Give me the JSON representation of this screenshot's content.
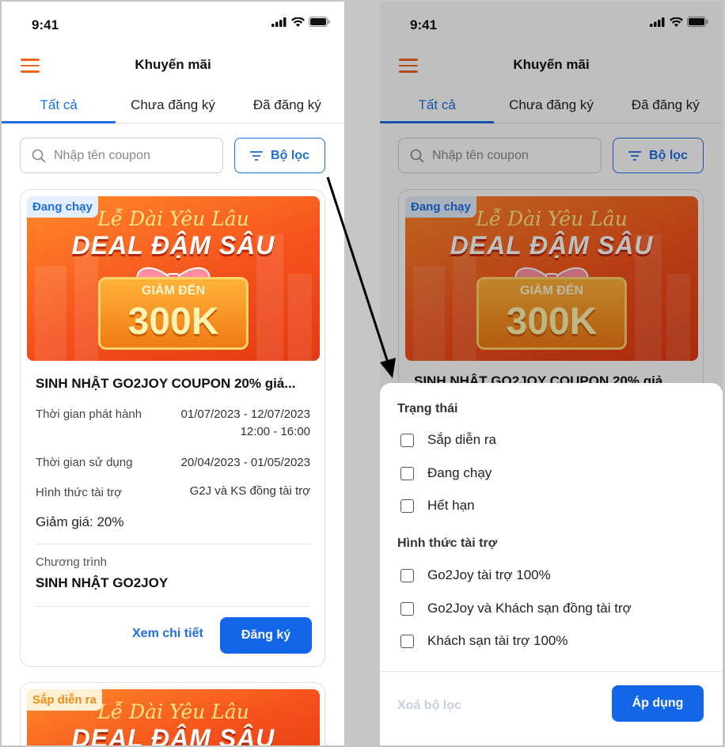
{
  "status": {
    "time": "9:41"
  },
  "header": {
    "title": "Khuyến mãi"
  },
  "tabs": [
    {
      "label": "Tất cả",
      "active": true
    },
    {
      "label": "Chưa đăng ký",
      "active": false
    },
    {
      "label": "Đã đăng ký",
      "active": false
    }
  ],
  "search": {
    "placeholder": "Nhập tên coupon"
  },
  "filter_button": {
    "label": "Bộ lọc"
  },
  "card": {
    "badge": "Đang chạy",
    "banner": {
      "line1": "Lễ Dài Yêu Lâu",
      "line2": "DEAL ĐẬM SÂU",
      "small": "GIẢM ĐẾN",
      "big": "300K"
    },
    "title": "SINH NHẬT GO2JOY COUPON 20% giả...",
    "rows": [
      {
        "label": "Thời gian phát hành",
        "value": "01/07/2023 - 12/07/2023",
        "value2": "12:00 - 16:00"
      },
      {
        "label": "Thời gian sử dụng",
        "value": "20/04/2023 - 01/05/2023"
      },
      {
        "label": "Hình thức tài trợ",
        "value": "G2J và KS đồng tài trợ"
      }
    ],
    "discount": "Giảm giá: 20%",
    "program_label": "Chương trình",
    "program_value": "SINH NHẬT GO2JOY",
    "detail_link": "Xem chi tiết",
    "register_button": "Đăng ký"
  },
  "card2": {
    "badge": "Sắp diễn ra",
    "banner": {
      "line1": "Lễ Dài Yêu Lâu",
      "line2": "DEAL ĐẬM SÂU"
    }
  },
  "card_b_title_partial": "SINH NHẬT GO2JOY COUPON 20% giả",
  "filter_sheet": {
    "status_title": "Trạng thái",
    "status_options": [
      "Sắp diễn ra",
      "Đang chạy",
      "Hết hạn"
    ],
    "sponsor_title": "Hình thức tài trợ",
    "sponsor_options": [
      "Go2Joy tài trợ 100%",
      "Go2Joy và Khách sạn đồng tài trợ",
      "Khách sạn tài trợ 100%"
    ],
    "clear_label": "Xoá bộ lọc",
    "apply_label": "Áp dụng"
  },
  "colors": {
    "primary": "#1366e8",
    "accent": "#f0651e",
    "tab_active": "#1f6fe0"
  }
}
